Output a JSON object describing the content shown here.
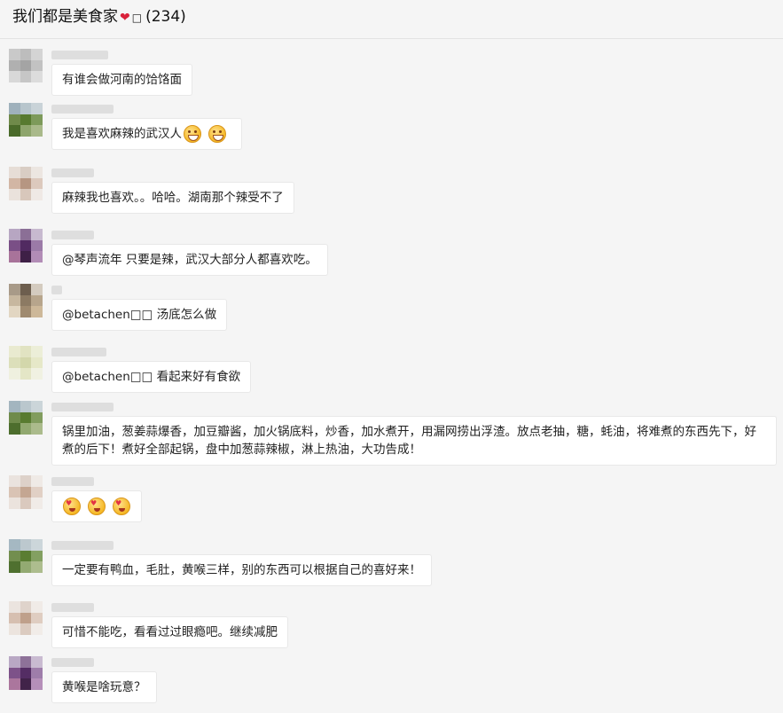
{
  "header": {
    "title_text": "我们都是美食家",
    "heart": "❤",
    "box": "□",
    "count": "(234)"
  },
  "messages": [
    {
      "text": "有谁会做河南的饸饹面"
    },
    {
      "text": "我是喜欢麻辣的武汉人",
      "emojis": [
        "grin-icon",
        "grin-icon"
      ]
    },
    {
      "text": "麻辣我也喜欢。。哈哈。湖南那个辣受不了"
    },
    {
      "text": "@琴声流年 只要是辣，武汉大部分人都喜欢吃。"
    },
    {
      "text": "@betachen□□ 汤底怎么做"
    },
    {
      "text": "@betachen□□ 看起来好有食欲"
    },
    {
      "text": "锅里加油，葱姜蒜爆香，加豆瓣酱，加火锅底料，炒香，加水煮开，用漏网捞出浮渣。放点老抽，糖，蚝油，将难煮的东西先下，好煮的后下！煮好全部起锅，盘中加葱蒜辣椒，淋上热油，大功告成！"
    },
    {
      "text": "",
      "emojis": [
        "heart-eyes-icon",
        "heart-eyes-icon",
        "heart-eyes-icon"
      ]
    },
    {
      "text": "一定要有鸭血，毛肚，黄喉三样，别的东西可以根据自己的喜好来！"
    },
    {
      "text": "可惜不能吃，看看过过眼瘾吧。继续减肥"
    },
    {
      "text": "黄喉是啥玩意？"
    }
  ]
}
